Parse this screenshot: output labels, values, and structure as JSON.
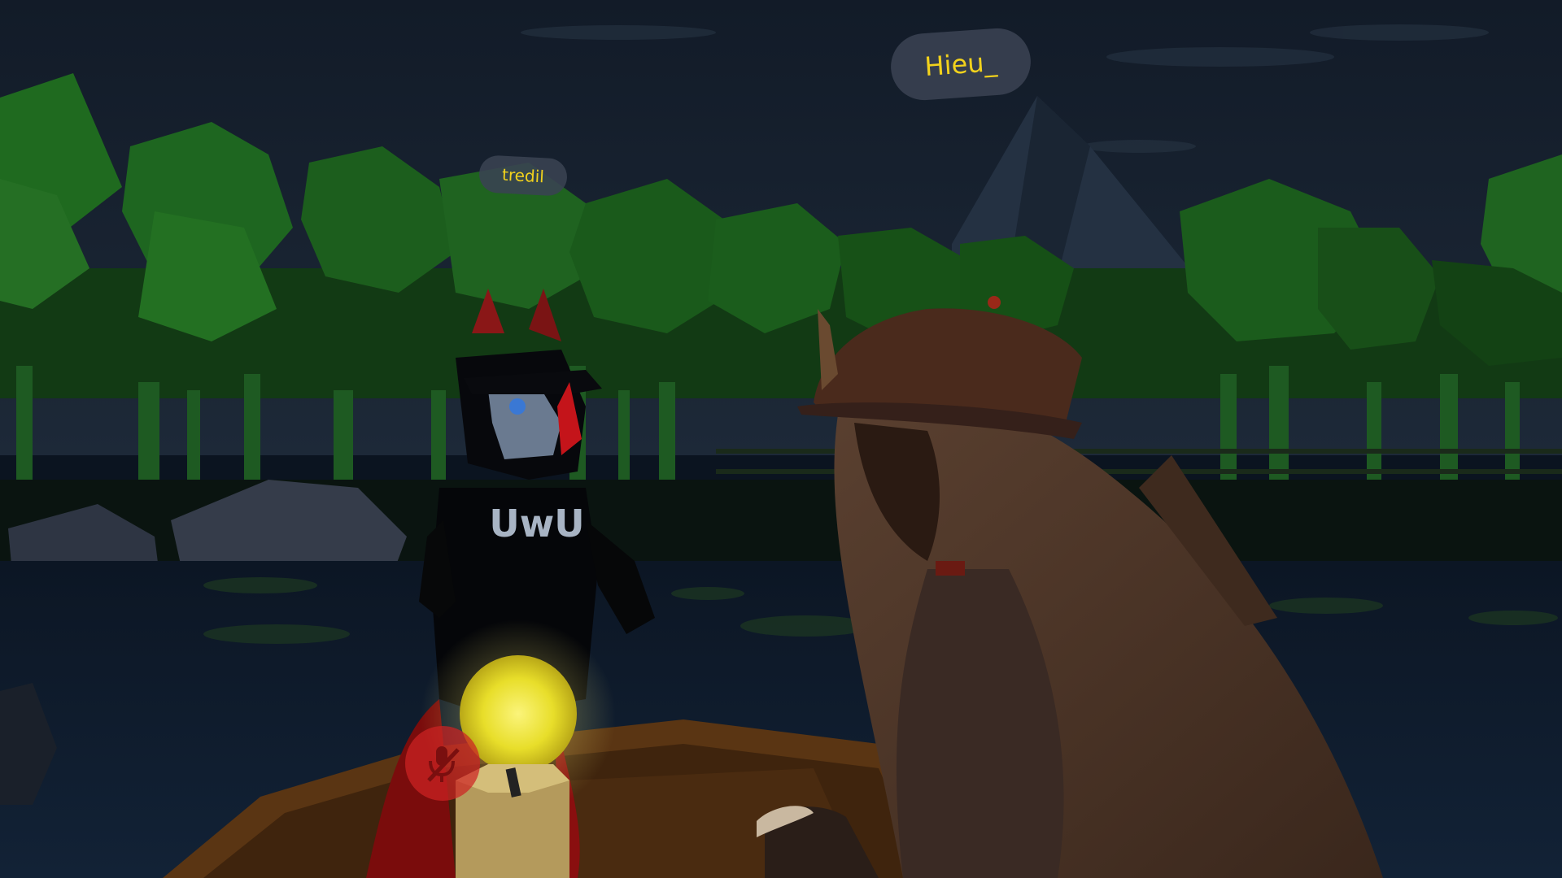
{
  "players": [
    {
      "name": "Hieu_"
    },
    {
      "name": "tredil"
    }
  ],
  "avatar_shirt_text": "UwU",
  "hud": {
    "mute_icon": "mic-muted-icon",
    "mute_color": "#d12a2a"
  },
  "colors": {
    "nameplate_text": "#f2d21c",
    "nameplate_bg": "#3a4252",
    "sky": "#16202e",
    "foliage": "#1f6a1f",
    "water": "#0e1a28",
    "lantern_glow": "#f4ea3a"
  }
}
